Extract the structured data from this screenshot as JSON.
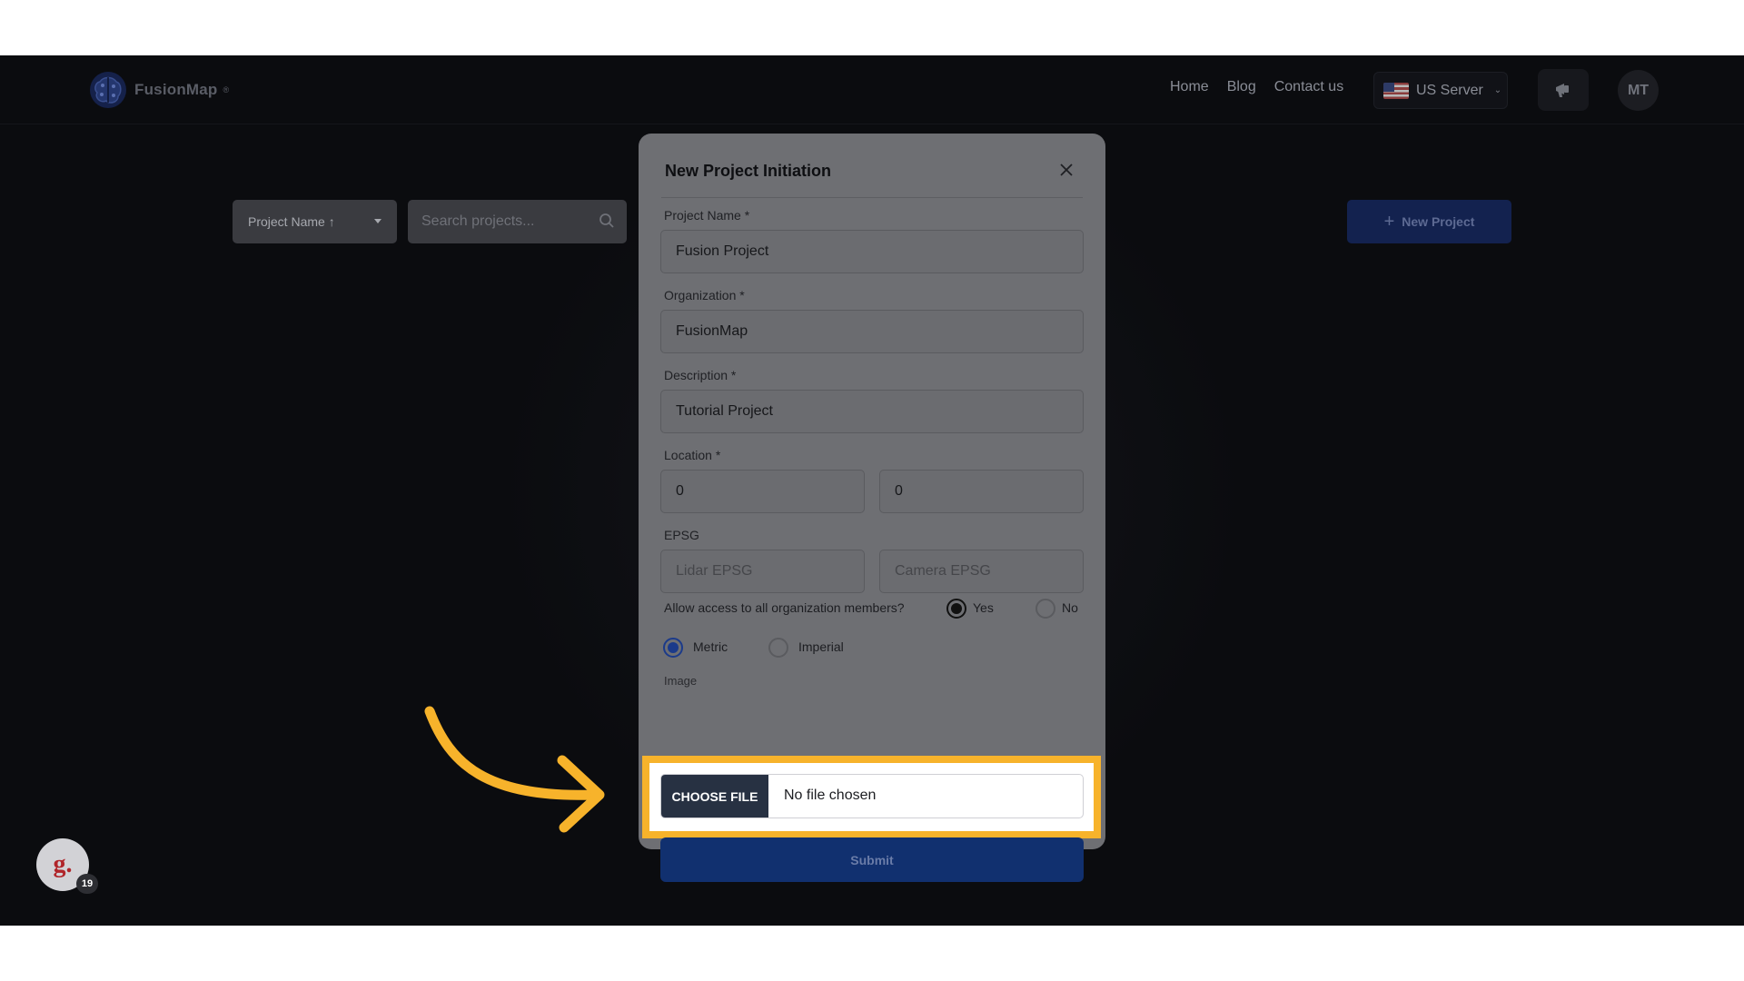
{
  "header": {
    "brand": "FusionMap",
    "nav": [
      "Home",
      "Blog",
      "Contact us"
    ],
    "server_label": "US Server",
    "avatar_initials": "MT"
  },
  "toolbar": {
    "sort_label": "Project Name ↑",
    "search_placeholder": "Search projects...",
    "new_project_label": "New Project"
  },
  "modal": {
    "title": "New Project Initiation",
    "fields": {
      "project_name": {
        "label": "Project Name *",
        "value": "Fusion Project"
      },
      "organization": {
        "label": "Organization *",
        "value": "FusionMap"
      },
      "description": {
        "label": "Description *",
        "value": "Tutorial Project"
      },
      "location": {
        "label": "Location *",
        "lat": "0",
        "lon": "0"
      },
      "epsg": {
        "label": "EPSG",
        "lidar_placeholder": "Lidar EPSG",
        "camera_placeholder": "Camera EPSG"
      }
    },
    "access": {
      "question": "Allow access to all organization members?",
      "yes": "Yes",
      "no": "No",
      "selected": "Yes"
    },
    "units": {
      "metric": "Metric",
      "imperial": "Imperial",
      "selected": "Metric"
    },
    "image": {
      "label": "Image",
      "button": "CHOOSE FILE",
      "status": "No file chosen"
    },
    "submit_label": "Submit"
  },
  "guide_badge": {
    "letter": "g.",
    "count": "19"
  },
  "colors": {
    "highlight": "#f7b32b",
    "primary": "#11306f",
    "file_button": "#273142"
  }
}
